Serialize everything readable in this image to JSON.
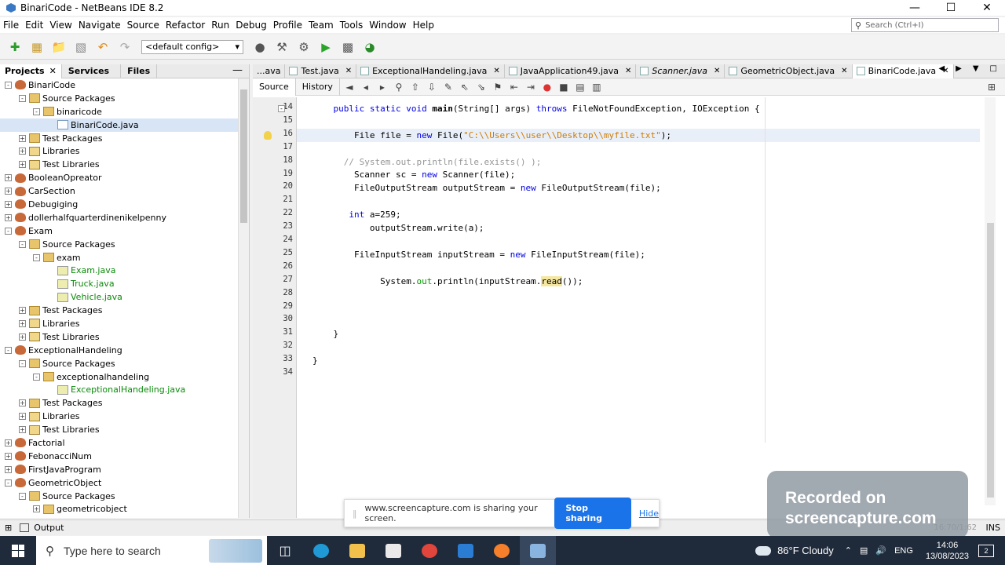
{
  "window": {
    "title": "BinariCode - NetBeans IDE 8.2"
  },
  "menu": [
    "File",
    "Edit",
    "View",
    "Navigate",
    "Source",
    "Refactor",
    "Run",
    "Debug",
    "Profile",
    "Team",
    "Tools",
    "Window",
    "Help"
  ],
  "search": {
    "placeholder": "Search (Ctrl+I)"
  },
  "toolbar": {
    "config": "<default config>"
  },
  "left_panel": {
    "tabs": [
      "Projects",
      "Services",
      "Files"
    ],
    "tree": [
      {
        "label": "BinariCode",
        "type": "proj",
        "depth": 0,
        "exp": "-"
      },
      {
        "label": "Source Packages",
        "type": "pkg",
        "depth": 1,
        "exp": "-"
      },
      {
        "label": "binaricode",
        "type": "pkg",
        "depth": 2,
        "exp": "-"
      },
      {
        "label": "BinariCode.java",
        "type": "java",
        "depth": 3,
        "exp": "",
        "selected": true
      },
      {
        "label": "Test Packages",
        "type": "pkg",
        "depth": 1,
        "exp": "+"
      },
      {
        "label": "Libraries",
        "type": "lib",
        "depth": 1,
        "exp": "+"
      },
      {
        "label": "Test Libraries",
        "type": "lib",
        "depth": 1,
        "exp": "+"
      },
      {
        "label": "BooleanOpreator",
        "type": "proj",
        "depth": 0,
        "exp": "+"
      },
      {
        "label": "CarSection",
        "type": "proj",
        "depth": 0,
        "exp": "+"
      },
      {
        "label": "Debugiging",
        "type": "proj",
        "depth": 0,
        "exp": "+"
      },
      {
        "label": "dollerhalfquarterdinenikelpenny",
        "type": "proj",
        "depth": 0,
        "exp": "+"
      },
      {
        "label": "Exam",
        "type": "proj",
        "depth": 0,
        "exp": "-"
      },
      {
        "label": "Source Packages",
        "type": "pkg",
        "depth": 1,
        "exp": "-"
      },
      {
        "label": "exam",
        "type": "pkg",
        "depth": 2,
        "exp": "-"
      },
      {
        "label": "Exam.java",
        "type": "exam",
        "depth": 3,
        "exp": "",
        "green": true
      },
      {
        "label": "Truck.java",
        "type": "exam",
        "depth": 3,
        "exp": "",
        "green": true
      },
      {
        "label": "Vehicle.java",
        "type": "exam",
        "depth": 3,
        "exp": "",
        "green": true
      },
      {
        "label": "Test Packages",
        "type": "pkg",
        "depth": 1,
        "exp": "+"
      },
      {
        "label": "Libraries",
        "type": "lib",
        "depth": 1,
        "exp": "+"
      },
      {
        "label": "Test Libraries",
        "type": "lib",
        "depth": 1,
        "exp": "+"
      },
      {
        "label": "ExceptionalHandeling",
        "type": "proj",
        "depth": 0,
        "exp": "-"
      },
      {
        "label": "Source Packages",
        "type": "pkg",
        "depth": 1,
        "exp": "-"
      },
      {
        "label": "exceptionalhandeling",
        "type": "pkg",
        "depth": 2,
        "exp": "-"
      },
      {
        "label": "ExceptionalHandeling.java",
        "type": "exam",
        "depth": 3,
        "exp": "",
        "green": true
      },
      {
        "label": "Test Packages",
        "type": "pkg",
        "depth": 1,
        "exp": "+"
      },
      {
        "label": "Libraries",
        "type": "lib",
        "depth": 1,
        "exp": "+"
      },
      {
        "label": "Test Libraries",
        "type": "lib",
        "depth": 1,
        "exp": "+"
      },
      {
        "label": "Factorial",
        "type": "proj",
        "depth": 0,
        "exp": "+"
      },
      {
        "label": "FebonacciNum",
        "type": "proj",
        "depth": 0,
        "exp": "+"
      },
      {
        "label": "FirstJavaProgram",
        "type": "proj",
        "depth": 0,
        "exp": "+"
      },
      {
        "label": "GeometricObject",
        "type": "proj",
        "depth": 0,
        "exp": "-"
      },
      {
        "label": "Source Packages",
        "type": "pkg",
        "depth": 1,
        "exp": "-"
      },
      {
        "label": "geometricobject",
        "type": "pkg",
        "depth": 2,
        "exp": "+"
      }
    ]
  },
  "editor": {
    "tabs": [
      {
        "label": "...ava",
        "active": false,
        "italic": false,
        "close": false
      },
      {
        "label": "Test.java",
        "active": false,
        "italic": false,
        "close": true
      },
      {
        "label": "ExceptionalHandeling.java",
        "active": false,
        "italic": false,
        "close": true
      },
      {
        "label": "JavaApplication49.java",
        "active": false,
        "italic": false,
        "close": true
      },
      {
        "label": "Scanner.java",
        "active": false,
        "italic": true,
        "close": true
      },
      {
        "label": "GeometricObject.java",
        "active": false,
        "italic": false,
        "close": true
      },
      {
        "label": "BinariCode.java",
        "active": true,
        "italic": false,
        "close": true
      }
    ],
    "view_buttons": [
      "Source",
      "History"
    ],
    "lines": [
      {
        "n": "14",
        "indent": "    ",
        "tokens": [
          [
            "kw",
            "public static "
          ],
          [
            "kw",
            "void "
          ],
          [
            "bold",
            "main"
          ],
          [
            "",
            "(String[] args) "
          ],
          [
            "kw",
            "throws "
          ],
          [
            "",
            "FileNotFoundException, IOException {"
          ]
        ]
      },
      {
        "n": "15",
        "indent": "",
        "tokens": []
      },
      {
        "n": "16",
        "indent": "        ",
        "tokens": [
          [
            "",
            "File file = "
          ],
          [
            "kw",
            "new "
          ],
          [
            "",
            "File("
          ],
          [
            "str",
            "\"C:\\\\Users\\\\user\\\\Desktop\\\\myfile.txt\""
          ],
          [
            "",
            ");"
          ]
        ],
        "current": true
      },
      {
        "n": "17",
        "indent": "",
        "tokens": []
      },
      {
        "n": "18",
        "indent": "      ",
        "tokens": [
          [
            "cm",
            "// System.out.println(file.exists() );"
          ]
        ]
      },
      {
        "n": "19",
        "indent": "        ",
        "tokens": [
          [
            "",
            "Scanner sc = "
          ],
          [
            "kw",
            "new "
          ],
          [
            "",
            "Scanner(file);"
          ]
        ]
      },
      {
        "n": "20",
        "indent": "        ",
        "tokens": [
          [
            "",
            "FileOutputStream outputStream = "
          ],
          [
            "kw",
            "new "
          ],
          [
            "",
            "FileOutputStream(file);"
          ]
        ]
      },
      {
        "n": "21",
        "indent": "",
        "tokens": []
      },
      {
        "n": "22",
        "indent": "       ",
        "tokens": [
          [
            "kw",
            "int "
          ],
          [
            "",
            "a=259;"
          ]
        ]
      },
      {
        "n": "23",
        "indent": "           ",
        "tokens": [
          [
            "",
            "outputStream.write(a);"
          ]
        ]
      },
      {
        "n": "24",
        "indent": "",
        "tokens": []
      },
      {
        "n": "25",
        "indent": "        ",
        "tokens": [
          [
            "",
            "FileInputStream inputStream = "
          ],
          [
            "kw",
            "new "
          ],
          [
            "",
            "FileInputStream(file);"
          ]
        ]
      },
      {
        "n": "26",
        "indent": "",
        "tokens": []
      },
      {
        "n": "27",
        "indent": "             ",
        "tokens": [
          [
            "",
            "System."
          ],
          [
            "fld",
            "out"
          ],
          [
            "",
            ".println(inputStream."
          ],
          [
            "hl",
            "read"
          ],
          [
            "",
            "());"
          ]
        ]
      },
      {
        "n": "28",
        "indent": "",
        "tokens": []
      },
      {
        "n": "29",
        "indent": "",
        "tokens": []
      },
      {
        "n": "30",
        "indent": "",
        "tokens": []
      },
      {
        "n": "31",
        "indent": "    ",
        "tokens": [
          [
            "",
            "}"
          ]
        ]
      },
      {
        "n": "32",
        "indent": "",
        "tokens": []
      },
      {
        "n": "33",
        "indent": "",
        "tokens": [
          [
            "",
            "}"
          ]
        ]
      },
      {
        "n": "34",
        "indent": "",
        "tokens": []
      }
    ]
  },
  "status": {
    "output_label": "Output",
    "position": "16:70/1:62",
    "mode": "INS"
  },
  "share_bar": {
    "message": "www.screencapture.com is sharing your screen.",
    "stop_label": "Stop sharing",
    "hide_label": "Hide"
  },
  "watermark": {
    "line1": "Recorded on",
    "line2": "screencapture.com"
  },
  "taskbar": {
    "search_placeholder": "Type here to search",
    "weather": "86°F  Cloudy",
    "lang": "ENG",
    "time": "14:06",
    "date": "13/08/2023",
    "notif_count": "2"
  }
}
